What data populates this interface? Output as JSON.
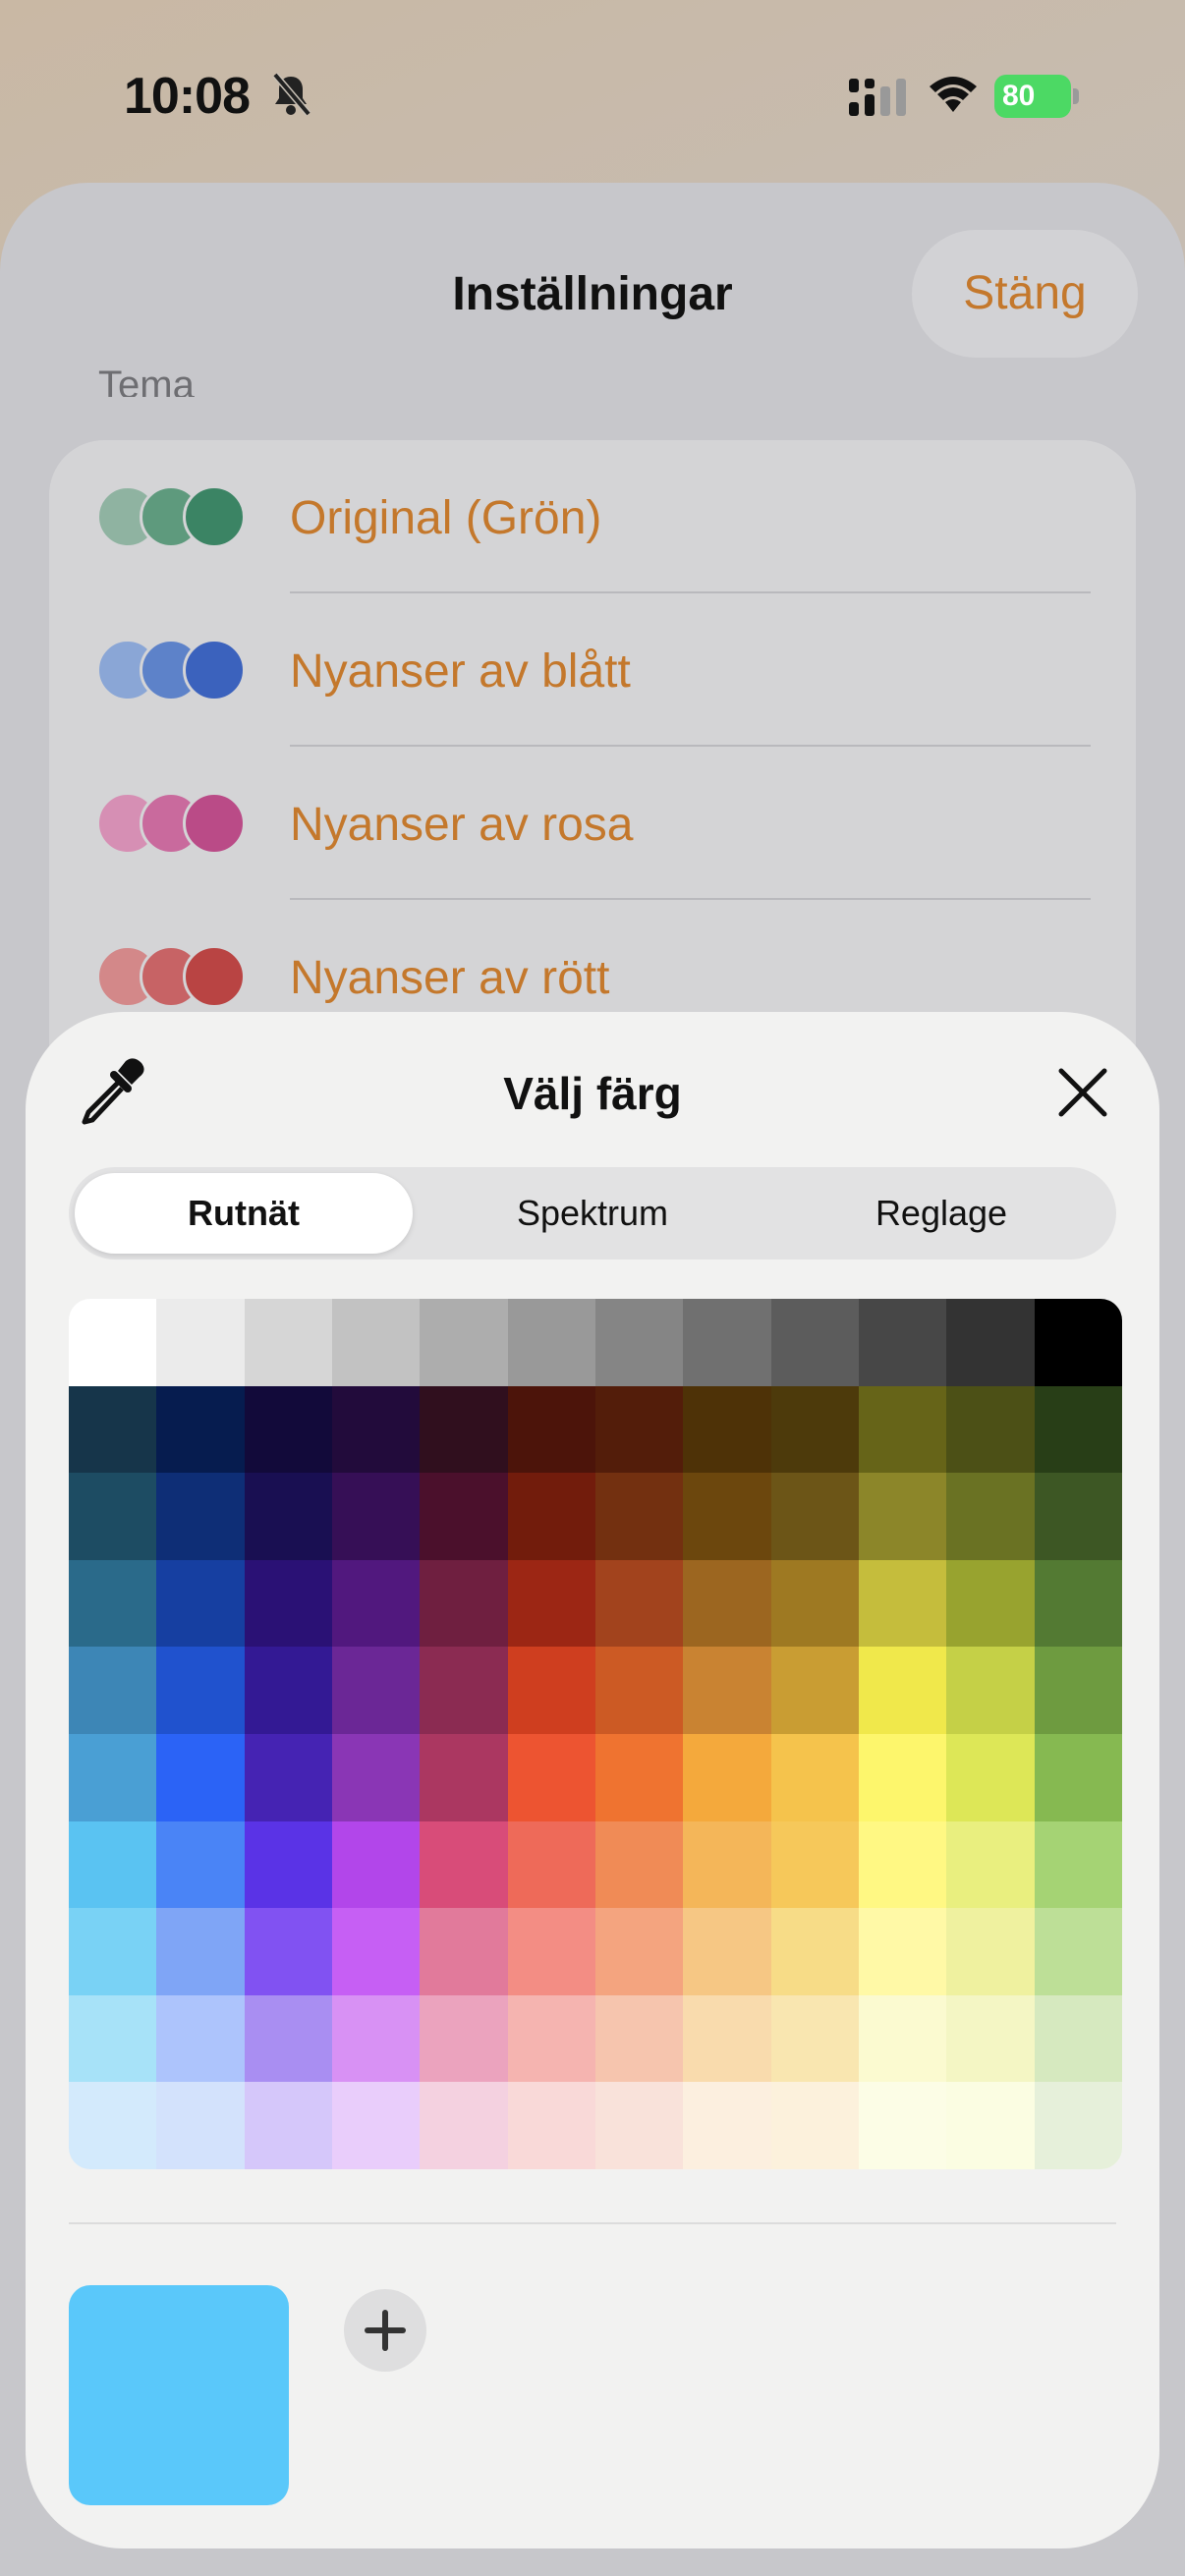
{
  "status_bar": {
    "time": "10:08",
    "battery": "80"
  },
  "settings": {
    "title": "Inställningar",
    "close_label": "Stäng",
    "section_label": "Tema",
    "themes": [
      {
        "label": "Original (Grön)",
        "colors": [
          "#8fb3a1",
          "#5e9a7d",
          "#3b8464"
        ]
      },
      {
        "label": "Nyanser av blått",
        "colors": [
          "#8aa6d6",
          "#5d82c9",
          "#3b62bd"
        ]
      },
      {
        "label": "Nyanser av rosa",
        "colors": [
          "#d68fb4",
          "#c96a9d",
          "#ba4b87"
        ]
      },
      {
        "label": "Nyanser av rött",
        "colors": [
          "#d38889",
          "#c76365",
          "#b94443"
        ]
      }
    ]
  },
  "picker": {
    "title": "Välj färg",
    "tabs": [
      "Rutnät",
      "Spektrum",
      "Reglage"
    ],
    "active_tab": "Rutnät",
    "selected_color": "#5ac8fa",
    "grid_colors": [
      [
        "#ffffff",
        "#ebebeb",
        "#d6d6d6",
        "#c2c2c2",
        "#adadad",
        "#999999",
        "#858585",
        "#707070",
        "#5c5c5c",
        "#474747",
        "#333333",
        "#000000"
      ],
      [
        "#16354a",
        "#061c4f",
        "#120a3a",
        "#220b3b",
        "#300f1e",
        "#4c140a",
        "#531d0a",
        "#4e3207",
        "#4d3a0b",
        "#666418",
        "#4c5016",
        "#283e17"
      ],
      [
        "#1d4c63",
        "#0e2e76",
        "#190f52",
        "#360f56",
        "#4b102c",
        "#721c0c",
        "#733010",
        "#6c470d",
        "#6c5517",
        "#8c8629",
        "#6a7223",
        "#3d5724"
      ],
      [
        "#2a6a8a",
        "#163fa1",
        "#2a1175",
        "#51187e",
        "#6f1f40",
        "#9c2614",
        "#a2431d",
        "#9c6620",
        "#9e7922",
        "#c5bd3c",
        "#98a32f",
        "#537a33"
      ],
      [
        "#3d86b6",
        "#2052ce",
        "#331994",
        "#6b2796",
        "#8b2b52",
        "#cf3e1f",
        "#cc5a24",
        "#c98332",
        "#c99d33",
        "#f0e84b",
        "#c5d047",
        "#6e9b40"
      ],
      [
        "#4a9fd4",
        "#2b63f6",
        "#4523b3",
        "#8a36b5",
        "#ab3761",
        "#ed5431",
        "#ef7330",
        "#f4a93c",
        "#f5c34c",
        "#fdf66c",
        "#dde757",
        "#86b951"
      ],
      [
        "#5ac3f2",
        "#4a84f6",
        "#5a33e6",
        "#b246ea",
        "#d84c79",
        "#ee6a59",
        "#f08b56",
        "#f4b659",
        "#f6c85a",
        "#fff883",
        "#e9ef7f",
        "#a5d374"
      ],
      [
        "#79d2f5",
        "#7fa5f6",
        "#8152f2",
        "#c65ff4",
        "#e17a9b",
        "#f38d84",
        "#f4a47f",
        "#f6c784",
        "#f7dc87",
        "#fff9a6",
        "#eff19f",
        "#bddf97"
      ],
      [
        "#a7e2f8",
        "#adc4fc",
        "#a98ef2",
        "#d891f4",
        "#eba3be",
        "#f5b4b0",
        "#f6c5ae",
        "#f9dbad",
        "#f9e6b0",
        "#fbfad0",
        "#f4f6c4",
        "#d6e9bf"
      ],
      [
        "#d3eafc",
        "#d3e2fc",
        "#d5c7fa",
        "#e9cdfb",
        "#f4d1e0",
        "#f9d9d8",
        "#f9e2da",
        "#fcefdf",
        "#fcf1dc",
        "#fcfde6",
        "#fbfde2",
        "#e6f0da"
      ]
    ],
    "eyedropper_icon": "eyedropper-icon",
    "close_icon": "close-icon",
    "add_icon": "plus-icon"
  }
}
